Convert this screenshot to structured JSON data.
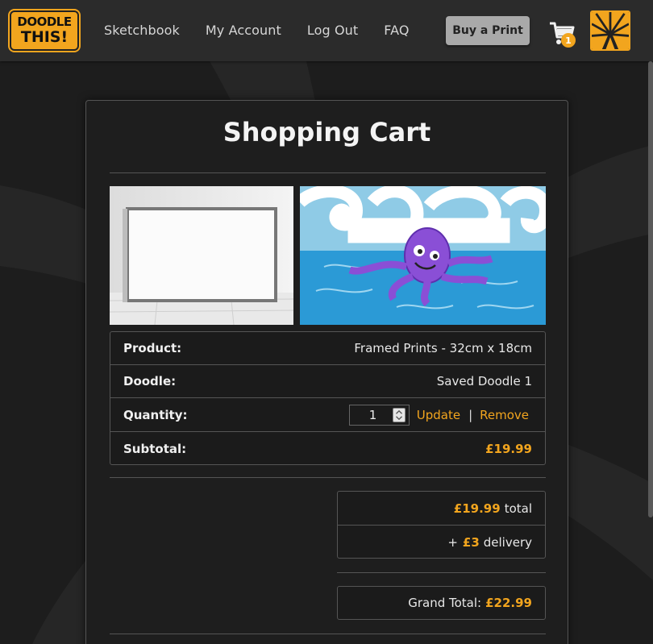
{
  "header": {
    "logo_line1": "DOODLE",
    "logo_line2": "THIS!",
    "nav": [
      "Sketchbook",
      "My Account",
      "Log Out",
      "FAQ"
    ],
    "buy_button": "Buy a Print",
    "cart_count": "1"
  },
  "cart": {
    "title": "Shopping Cart",
    "rows": {
      "product_label": "Product:",
      "product_value": "Framed Prints - 32cm x 18cm",
      "doodle_label": "Doodle:",
      "doodle_value": "Saved Doodle 1",
      "quantity_label": "Quantity:",
      "quantity_value": "1",
      "update_link": "Update",
      "separator": "|",
      "remove_link": "Remove",
      "subtotal_label": "Subtotal:",
      "subtotal_value": "£19.99"
    },
    "totals": {
      "total_amount": "£19.99",
      "total_word": "total",
      "delivery_prefix": "+",
      "delivery_amount": "£3",
      "delivery_word": "delivery",
      "grand_label": "Grand Total:",
      "grand_amount": "£22.99"
    }
  },
  "colors": {
    "accent": "#f2a51e",
    "background": "#1c1c1c",
    "header": "#2b2b2b",
    "border": "#555555"
  },
  "icons": [
    "cart-icon",
    "brand-sunburst-icon"
  ]
}
